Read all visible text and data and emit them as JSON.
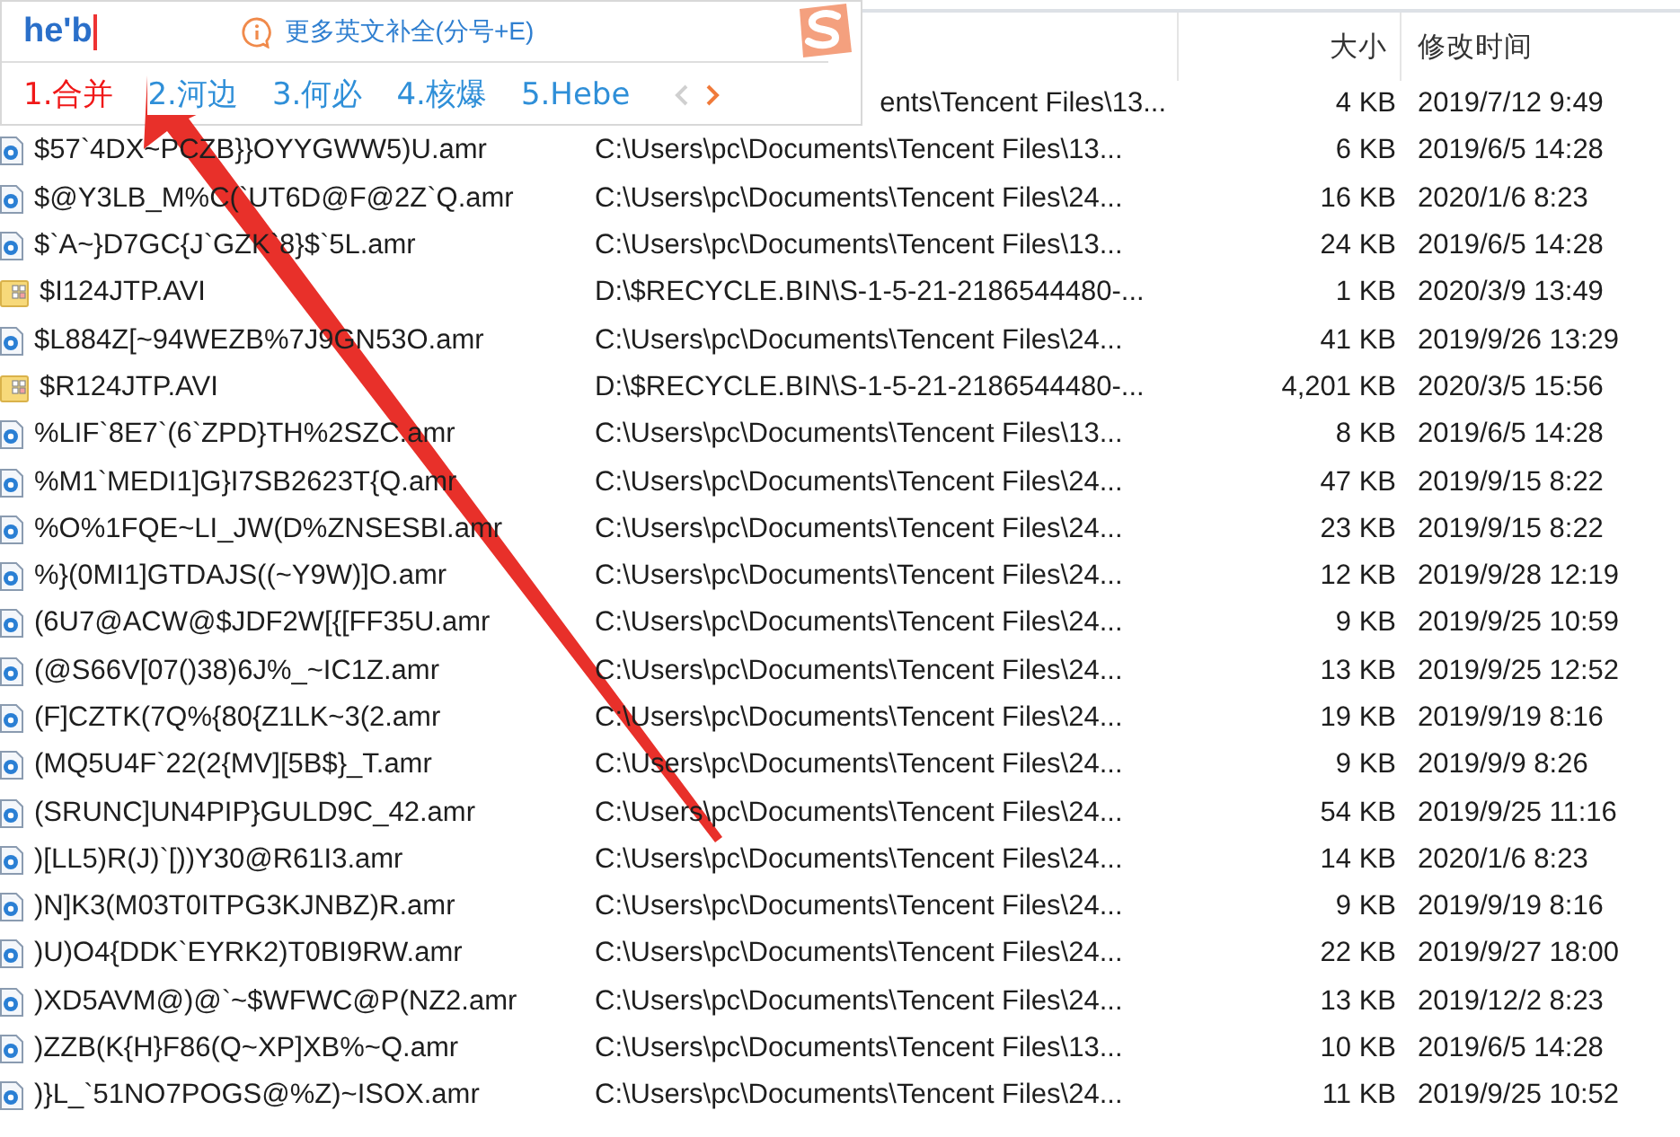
{
  "ime": {
    "input": "he'b",
    "hint": "更多英文补全(分号+E)",
    "candidates": [
      {
        "label": "1.合并",
        "selected": true
      },
      {
        "label": "2.河边",
        "selected": false
      },
      {
        "label": "3.何必",
        "selected": false
      },
      {
        "label": "4.核爆",
        "selected": false
      },
      {
        "label": "5.Hebe",
        "selected": false
      }
    ],
    "prev_disabled": true,
    "next_disabled": false
  },
  "table": {
    "columns": [
      {
        "label": "大小"
      },
      {
        "label": "修改时间"
      }
    ],
    "rows": [
      {
        "path": "ents\\Tencent Files\\13...",
        "clipped_left": true,
        "size": "4 KB",
        "modified": "2019/7/12 9:49"
      },
      {
        "kind": "audio",
        "name": "$57`4DX~PCZB}}OYYGWW5)U.amr",
        "path": "C:\\Users\\pc\\Documents\\Tencent Files\\13...",
        "size": "6 KB",
        "modified": "2019/6/5 14:28"
      },
      {
        "kind": "audio",
        "name": "$@Y3LB_M%C(`UT6D@F@2Z`Q.amr",
        "path": "C:\\Users\\pc\\Documents\\Tencent Files\\24...",
        "size": "16 KB",
        "modified": "2020/1/6 8:23"
      },
      {
        "kind": "audio",
        "name": "$`A~}D7GC{J`GZK`8}$`5L.amr",
        "path": "C:\\Users\\pc\\Documents\\Tencent Files\\13...",
        "size": "24 KB",
        "modified": "2019/6/5 14:28"
      },
      {
        "kind": "video",
        "name": "$I124JTP.AVI",
        "path": "D:\\$RECYCLE.BIN\\S-1-5-21-2186544480-...",
        "size": "1 KB",
        "modified": "2020/3/9 13:49"
      },
      {
        "kind": "audio",
        "name": "$L884Z[~94WEZB%7J9GN53O.amr",
        "path": "C:\\Users\\pc\\Documents\\Tencent Files\\24...",
        "size": "41 KB",
        "modified": "2019/9/26 13:29"
      },
      {
        "kind": "video",
        "name": "$R124JTP.AVI",
        "path": "D:\\$RECYCLE.BIN\\S-1-5-21-2186544480-...",
        "size": "4,201 KB",
        "modified": "2020/3/5 15:56"
      },
      {
        "kind": "audio",
        "name": "%LIF`8E7`(6`ZPD}TH%2SZC.amr",
        "path": "C:\\Users\\pc\\Documents\\Tencent Files\\13...",
        "size": "8 KB",
        "modified": "2019/6/5 14:28"
      },
      {
        "kind": "audio",
        "name": "%M1`MEDI1]G}I7SB2623T{Q.amr",
        "path": "C:\\Users\\pc\\Documents\\Tencent Files\\24...",
        "size": "47 KB",
        "modified": "2019/9/15 8:22"
      },
      {
        "kind": "audio",
        "name": "%O%1FQE~LI_JW(D%ZNSESBI.amr",
        "path": "C:\\Users\\pc\\Documents\\Tencent Files\\24...",
        "size": "23 KB",
        "modified": "2019/9/15 8:22"
      },
      {
        "kind": "audio",
        "name": "%}(0MI1]GTDAJS((~Y9W)]O.amr",
        "path": "C:\\Users\\pc\\Documents\\Tencent Files\\24...",
        "size": "12 KB",
        "modified": "2019/9/28 12:19"
      },
      {
        "kind": "audio",
        "name": "(6U7@ACW@$JDF2W[{[FF35U.amr",
        "path": "C:\\Users\\pc\\Documents\\Tencent Files\\24...",
        "size": "9 KB",
        "modified": "2019/9/25 10:59"
      },
      {
        "kind": "audio",
        "name": "(@S66V[07()38)6J%_~IC1Z.amr",
        "path": "C:\\Users\\pc\\Documents\\Tencent Files\\24...",
        "size": "13 KB",
        "modified": "2019/9/25 12:52"
      },
      {
        "kind": "audio",
        "name": "(F]CZTK(7Q%{80{Z1LK~3(2.amr",
        "path": "C:\\Users\\pc\\Documents\\Tencent Files\\24...",
        "size": "19 KB",
        "modified": "2019/9/19 8:16"
      },
      {
        "kind": "audio",
        "name": "(MQ5U4F`22(2{MV][5B$}_T.amr",
        "path": "C:\\Users\\pc\\Documents\\Tencent Files\\24...",
        "size": "9 KB",
        "modified": "2019/9/9 8:26"
      },
      {
        "kind": "audio",
        "name": "(SRUNC]UN4PIP}GULD9C_42.amr",
        "path": "C:\\Users\\pc\\Documents\\Tencent Files\\24...",
        "size": "54 KB",
        "modified": "2019/9/25 11:16"
      },
      {
        "kind": "audio",
        "name": ")[LL5)R(J)`[))Y30@R61I3.amr",
        "path": "C:\\Users\\pc\\Documents\\Tencent Files\\24...",
        "size": "14 KB",
        "modified": "2020/1/6 8:23"
      },
      {
        "kind": "audio",
        "name": ")N]K3(M03T0ITPG3KJNBZ)R.amr",
        "path": "C:\\Users\\pc\\Documents\\Tencent Files\\24...",
        "size": "9 KB",
        "modified": "2019/9/19 8:16"
      },
      {
        "kind": "audio",
        "name": ")U)O4{DDK`EYRK2)T0BI9RW.amr",
        "path": "C:\\Users\\pc\\Documents\\Tencent Files\\24...",
        "size": "22 KB",
        "modified": "2019/9/27 18:00"
      },
      {
        "kind": "audio",
        "name": ")XD5AVM@)@`~$WFWC@P(NZ2.amr",
        "path": "C:\\Users\\pc\\Documents\\Tencent Files\\24...",
        "size": "13 KB",
        "modified": "2019/12/2 8:23"
      },
      {
        "kind": "audio",
        "name": ")ZZB(K{H}F86(Q~XP]XB%~Q.amr",
        "path": "C:\\Users\\pc\\Documents\\Tencent Files\\13...",
        "size": "10 KB",
        "modified": "2019/6/5 14:28"
      },
      {
        "kind": "audio",
        "name": ")}L_`51NO7POGS@%Z)~ISOX.amr",
        "path": "C:\\Users\\pc\\Documents\\Tencent Files\\24...",
        "size": "11 KB",
        "modified": "2019/9/25 10:52"
      }
    ]
  }
}
